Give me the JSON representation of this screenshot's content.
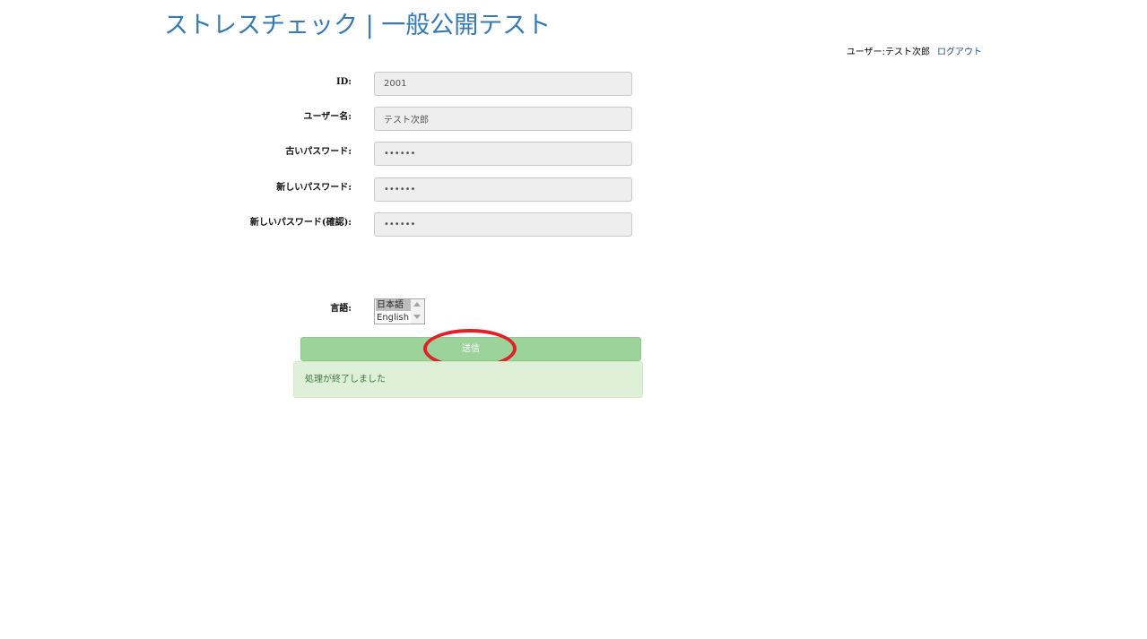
{
  "header": {
    "title": "ストレスチェック | 一般公開テスト",
    "user_label": "ユーザー:テスト次郎",
    "logout_label": "ログアウト"
  },
  "form": {
    "fields": [
      {
        "label": "ID:",
        "value": "2001"
      },
      {
        "label": "ユーザー名:",
        "value": "テスト次郎"
      },
      {
        "label": "古いパスワード:",
        "value": "••••••"
      },
      {
        "label": "新しいパスワード:",
        "value": "••••••"
      },
      {
        "label": "新しいパスワード(確認):",
        "value": "••••••"
      }
    ],
    "language": {
      "label": "言語:",
      "options": [
        "日本語",
        "English"
      ],
      "selected": "日本語"
    },
    "submit_label": "送信"
  },
  "message": {
    "text": "処理が終了しました"
  },
  "colors": {
    "title": "#337ab7",
    "submit": "#9bd39a",
    "annotation": "#e2202a",
    "alert_bg": "#dff0d8"
  }
}
